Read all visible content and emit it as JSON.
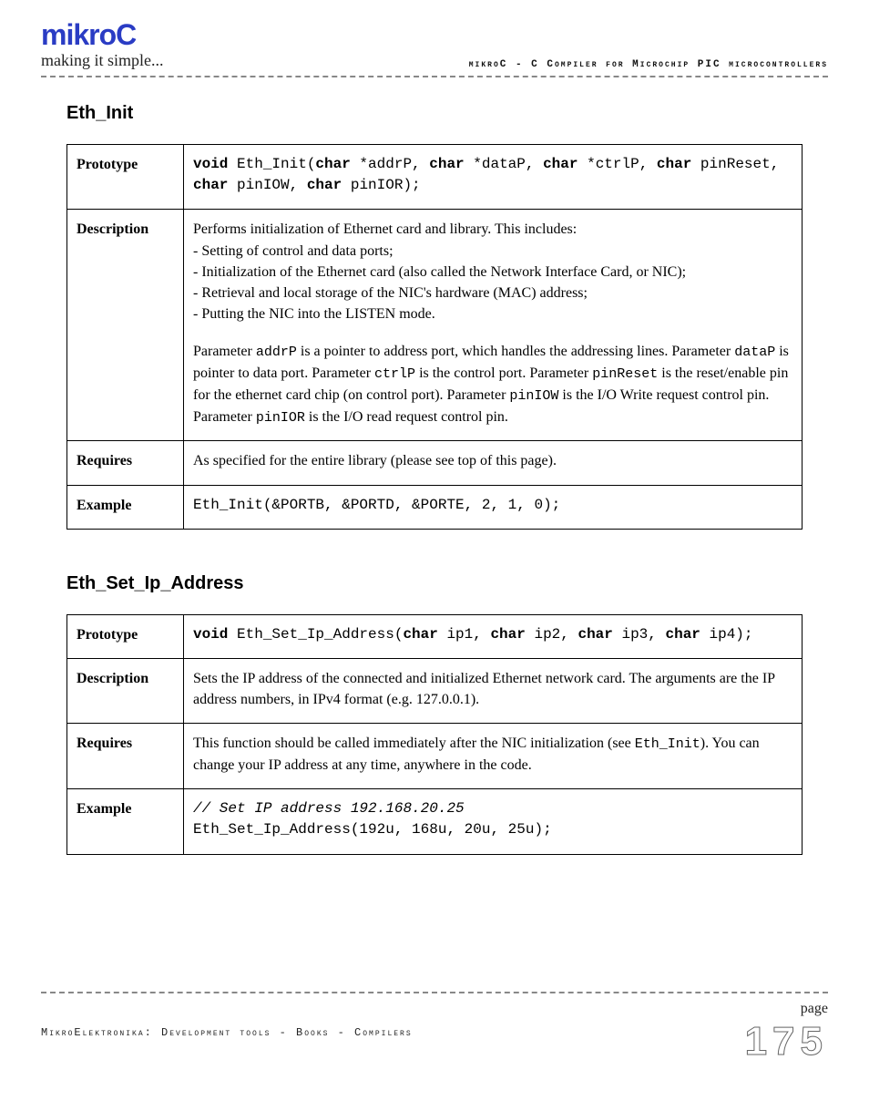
{
  "header": {
    "logo": "mikroC",
    "tagline": "making it simple...",
    "right": "mikroC - C Compiler for Microchip PIC microcontrollers"
  },
  "section1": {
    "title": "Eth_Init",
    "rows": {
      "prototype_label": "Prototype",
      "prototype_html": "<b>void</b> Eth_Init(<b>char</b> *addrP, <b>char</b> *dataP, <b>char</b> *ctrlP, <b>char</b> pinReset, <b>char</b> pinIOW, <b>char</b> pinIOR);",
      "description_label": "Description",
      "desc_intro": "Performs initialization of Ethernet card and library. This includes:",
      "desc_b1": "- Setting of control and data ports;",
      "desc_b2": "- Initialization of the Ethernet card (also called the Network Interface Card, or NIC);",
      "desc_b3": "- Retrieval and local storage of the NIC's hardware (MAC) address;",
      "desc_b4": "- Putting the NIC into the LISTEN mode.",
      "desc_para2_html": "Parameter <span class=\"mono\">addrP</span> is a pointer to address port, which handles the addressing lines. Parameter <span class=\"mono\">dataP</span> is pointer to data port. Parameter <span class=\"mono\">ctrlP</span> is the control port. Parameter <span class=\"mono\">pinReset</span> is the reset/enable pin for the ethernet card chip (on control port). Parameter <span class=\"mono\">pinIOW</span> is the I/O Write request control pin. Parameter <span class=\"mono\">pinIOR</span> is the I/O read request control pin.",
      "requires_label": "Requires",
      "requires_text": "As specified for the entire library (please see top of this page).",
      "example_label": "Example",
      "example_code": "Eth_Init(&PORTB, &PORTD, &PORTE, 2, 1, 0);"
    }
  },
  "section2": {
    "title": "Eth_Set_Ip_Address",
    "rows": {
      "prototype_label": "Prototype",
      "prototype_html": "<b>void</b> Eth_Set_Ip_Address(<b>char</b> ip1, <b>char</b> ip2, <b>char</b> ip3, <b>char</b> ip4);",
      "description_label": "Description",
      "description_text": "Sets the IP address of the connected and initialized Ethernet network card. The arguments are the IP address numbers, in IPv4 format (e.g. 127.0.0.1).",
      "requires_label": "Requires",
      "requires_html": "This function should be called immediately after the NIC initialization (see <span class=\"mono\">Eth_Init</span>). You can change your IP address at any time, anywhere in the code.",
      "example_label": "Example",
      "example_code_html": "<i>// Set IP address 192.168.20.25</i><br>Eth_Set_Ip_Address(192u, 168u, 20u, 25u);"
    }
  },
  "footer": {
    "left": "MikroElektronika: Development tools - Books - Compilers",
    "page_label": "page",
    "page_num": "175"
  }
}
